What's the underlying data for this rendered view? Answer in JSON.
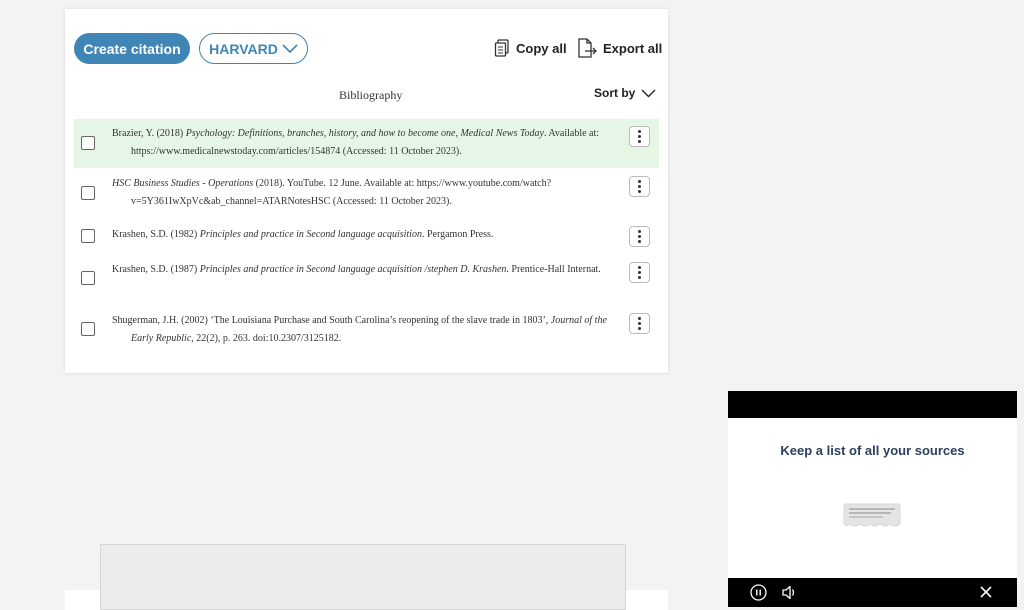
{
  "toolbar": {
    "create_label": "Create citation",
    "style_label": "HARVARD",
    "copy_label": "Copy all",
    "export_label": "Export all"
  },
  "bibliography": {
    "title": "Bibliography",
    "sort_label": "Sort by",
    "entries": [
      {
        "pre": "Brazier, Y. (2018) ",
        "italic": "Psychology: Definitions, branches, history, and how to become one",
        "mid": ", ",
        "italic2": "Medical News Today",
        "post": ". Available at: https://www.medicalnewstoday.com/articles/154874 (Accessed: 11 October 2023).",
        "highlighted": true
      },
      {
        "pre": "",
        "italic": "HSC Business Studies - Operations",
        "mid": " (2018). YouTube. 12 June. Available at: https://www.youtube.com/watch?v=5Y361IwXpVc&ab_channel=ATARNotesHSC (Accessed: 11 October 2023).",
        "italic2": "",
        "post": "",
        "highlighted": false
      },
      {
        "pre": "Krashen, S.D. (1982) ",
        "italic": "Principles and practice in Second language acquisition",
        "mid": ". Pergamon Press.",
        "italic2": "",
        "post": "",
        "highlighted": false
      },
      {
        "pre": "Krashen, S.D. (1987) ",
        "italic": "Principles and practice in Second language acquisition /stephen D. Krashen",
        "mid": ". Prentice-Hall Internat.",
        "italic2": "",
        "post": "",
        "highlighted": false
      },
      {
        "pre": "Shugerman, J.H. (2002) ‘The Louisiana Purchase and South Carolina’s reopening of the slave trade in 1803’, ",
        "italic": "Journal of the Early Republic",
        "mid": ", 22(2), p. 263. doi:10.2307/3125182.",
        "italic2": "",
        "post": "",
        "highlighted": false
      }
    ]
  },
  "video": {
    "heading": "Keep a list of all your sources"
  },
  "colors": {
    "accent": "#3f85b5",
    "highlight_row": "#e6f6e6",
    "video_heading": "#2d3f5e"
  },
  "icons": {
    "copy": "copy-icon",
    "export": "export-icon",
    "sort": "chevron-down-icon",
    "menu": "kebab-menu-icon",
    "pause": "pause-icon",
    "mute": "speaker-icon",
    "close": "close-icon"
  }
}
